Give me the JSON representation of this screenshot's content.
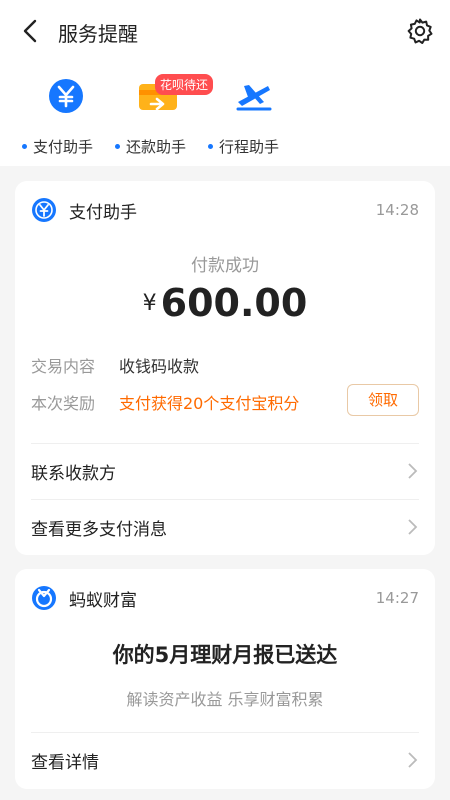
{
  "header": {
    "title": "服务提醒"
  },
  "assistants": [
    {
      "label": "支付助手",
      "icon": "yen-circle-icon"
    },
    {
      "label": "还款助手",
      "icon": "card-repay-icon",
      "badge": "花呗待还"
    },
    {
      "label": "行程助手",
      "icon": "airplane-icon"
    }
  ],
  "payment_card": {
    "name": "支付助手",
    "time": "14:28",
    "status": "付款成功",
    "currency": "¥",
    "amount": "600.00",
    "content_label": "交易内容",
    "content_value": "收钱码收款",
    "reward_label": "本次奖励",
    "reward_value": "支付获得20个支付宝积分",
    "claim_button": "领取",
    "link1": "联系收款方",
    "link2": "查看更多支付消息"
  },
  "wealth_card": {
    "name": "蚂蚁财富",
    "time": "14:27",
    "headline": "你的5月理财月报已送达",
    "subline": "解读资产收益 乐享财富积累",
    "link": "查看详情"
  },
  "colors": {
    "blue": "#1677ff",
    "orange": "#ff6a00",
    "badge_red": "#ff4d4f"
  }
}
